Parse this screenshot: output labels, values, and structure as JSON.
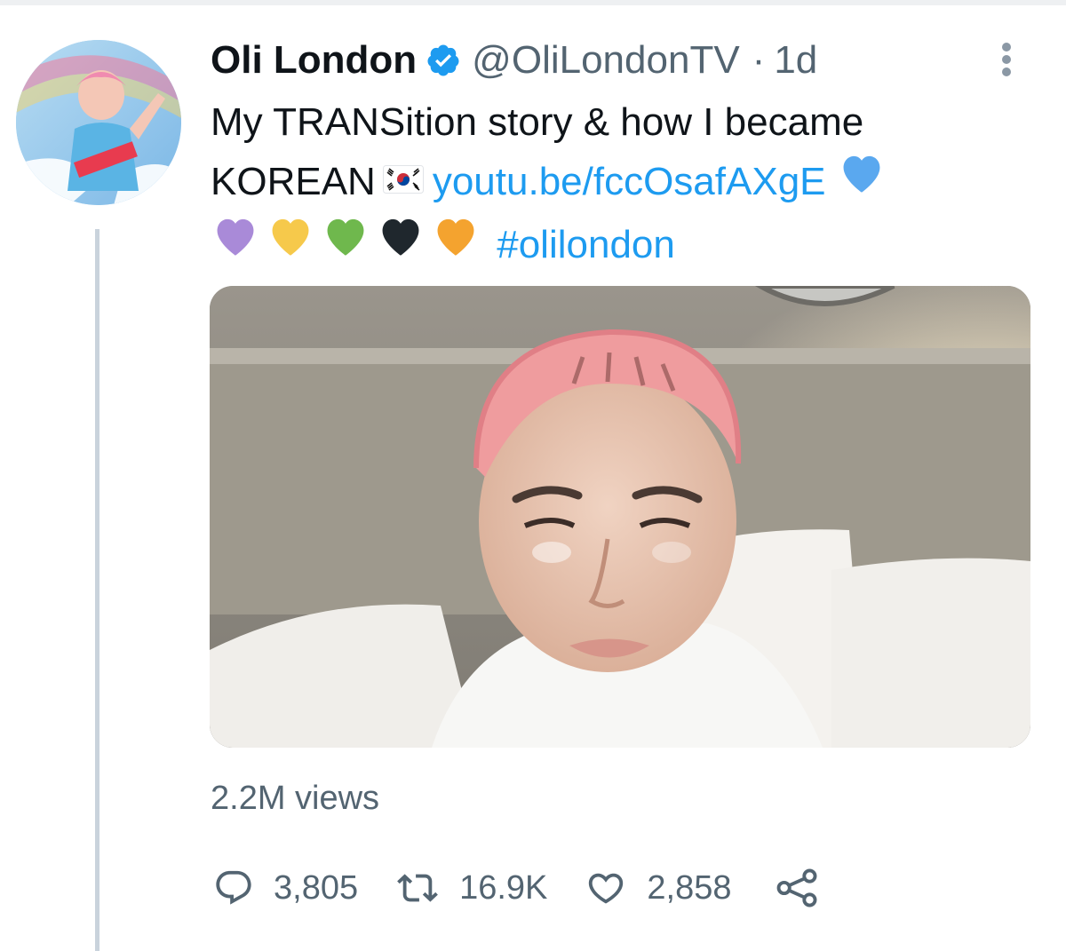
{
  "tweet": {
    "display_name": "Oli London",
    "handle": "@OliLondonTV",
    "separator": "·",
    "timestamp": "1d",
    "text_line1": "My TRANSition story & how I became",
    "text_word": "KOREAN",
    "link": "youtu.be/fccOsafAXgE",
    "hashtag": "#olilondon",
    "flag_icon": "south-korea-flag-icon",
    "heart_colors": [
      "#5aa8ef",
      "#a98ad8",
      "#f6c94b",
      "#6fb84d",
      "#1f272d",
      "#f4a32f"
    ]
  },
  "media": {
    "type": "video-thumbnail"
  },
  "stats": {
    "views": "2.2M views",
    "replies": "3,805",
    "retweets": "16.9K",
    "likes": "2,858"
  },
  "colors": {
    "accent": "#1d9bf0",
    "secondary_text": "#536471",
    "primary_text": "#0f1419"
  }
}
